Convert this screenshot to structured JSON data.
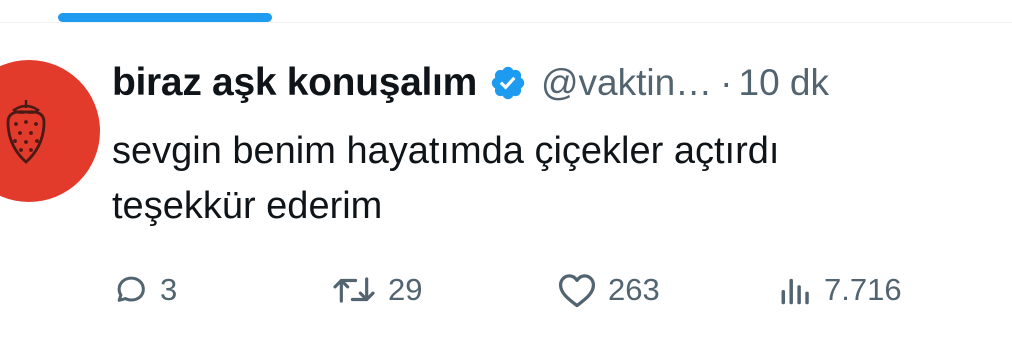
{
  "tweet": {
    "display_name": "biraz aşk konuşalım",
    "handle": "@vaktin…",
    "separator": "·",
    "time": "10 dk",
    "text_lines": [
      "sevgin benim hayatımda çiçekler açtırdı",
      "teşekkür ederim"
    ]
  },
  "actions": {
    "replies": "3",
    "retweets": "29",
    "likes": "263",
    "views": "7.716"
  },
  "icons": {
    "reply": "reply-icon",
    "retweet": "retweet-icon",
    "like": "heart-icon",
    "views": "views-icon",
    "verified": "verified-badge-icon"
  },
  "colors": {
    "accent": "#1d9bf0",
    "avatar_bg": "#e23a2b",
    "text": "#0f1419",
    "secondary": "#536471"
  }
}
